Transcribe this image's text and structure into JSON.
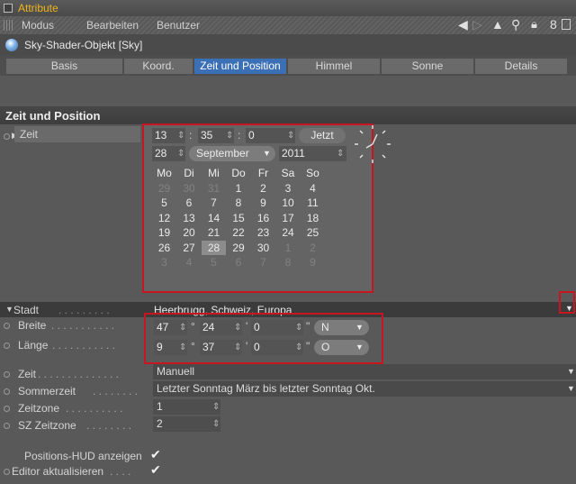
{
  "window": {
    "title": "Attribute"
  },
  "menu": [
    "Modus",
    "Bearbeiten",
    "Benutzer"
  ],
  "object": {
    "name": "Sky-Shader-Objekt [Sky]"
  },
  "tabs": [
    "Basis",
    "Koord.",
    "Zeit und Position",
    "Himmel",
    "Sonne",
    "Details"
  ],
  "active_tab": "Zeit und Position",
  "section": {
    "title": "Zeit und Position"
  },
  "zeit": {
    "label": "Zeit",
    "hour": "13",
    "minute": "35",
    "second": "0",
    "now_button": "Jetzt",
    "day": "28",
    "month": "September",
    "year": "2011"
  },
  "calendar": {
    "headers": [
      "Mo",
      "Di",
      "Mi",
      "Do",
      "Fr",
      "Sa",
      "So"
    ],
    "rows": [
      [
        "29",
        "30",
        "31",
        "1",
        "2",
        "3",
        "4"
      ],
      [
        "5",
        "6",
        "7",
        "8",
        "9",
        "10",
        "11"
      ],
      [
        "12",
        "13",
        "14",
        "15",
        "16",
        "17",
        "18"
      ],
      [
        "19",
        "20",
        "21",
        "22",
        "23",
        "24",
        "25"
      ],
      [
        "26",
        "27",
        "28",
        "29",
        "30",
        "1",
        "2"
      ],
      [
        "3",
        "4",
        "5",
        "6",
        "7",
        "8",
        "9"
      ]
    ],
    "selected": "28"
  },
  "stadt": {
    "label": "Stadt",
    "value": "Heerbrugg, Schweiz, Europa"
  },
  "breite": {
    "label": "Breite",
    "deg": "47",
    "min": "24",
    "sec": "0",
    "dir": "N"
  },
  "laenge": {
    "label": "Länge",
    "deg": "9",
    "min": "37",
    "sec": "0",
    "dir": "O"
  },
  "zeit_mode": {
    "label": "Zeit",
    "value": "Manuell"
  },
  "sommerzeit": {
    "label": "Sommerzeit",
    "value": "Letzter Sonntag März bis letzter Sonntag Okt."
  },
  "zeitzone": {
    "label": "Zeitzone",
    "value": "1"
  },
  "sz_zeitzone": {
    "label": "SZ Zeitzone",
    "value": "2"
  },
  "hud": {
    "label": "Positions-HUD anzeigen",
    "checked": true
  },
  "editor": {
    "label": "Editor aktualisieren",
    "checked": true
  },
  "colors": {
    "accent": "#f2b61c",
    "tab_active": "#3b6fb6",
    "highlight": "#c7161f"
  }
}
